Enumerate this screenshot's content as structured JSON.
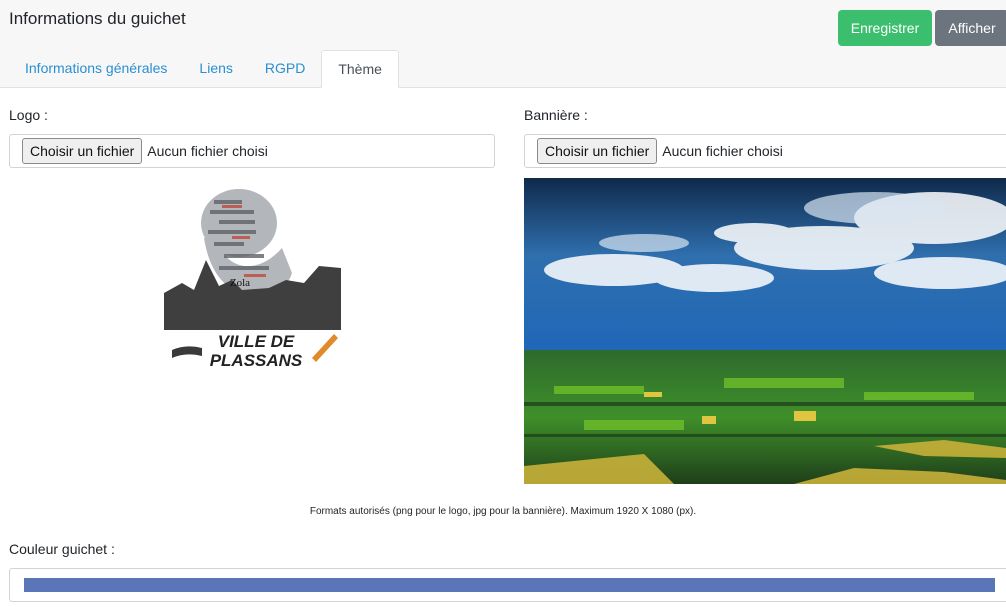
{
  "header": {
    "title": "Informations du guichet",
    "save_label": "Enregistrer",
    "show_label": "Afficher"
  },
  "tabs": [
    {
      "label": "Informations générales",
      "active": false
    },
    {
      "label": "Liens",
      "active": false
    },
    {
      "label": "RGPD",
      "active": false
    },
    {
      "label": "Thème",
      "active": true
    }
  ],
  "logo": {
    "label": "Logo :",
    "choose_button": "Choisir un fichier",
    "status": "Aucun fichier choisi",
    "image_text_line1": "VILLE DE",
    "image_text_line2": "PLASSANS",
    "image_text_name": "Zola"
  },
  "banner": {
    "label": "Bannière :",
    "choose_button": "Choisir un fichier",
    "status": "Aucun fichier choisi"
  },
  "formats_note": "Formats autorisés (png pour le logo, jpg pour la bannière). Maximum 1920 X 1080 (px).",
  "color": {
    "label": "Couleur guichet :",
    "value": "#5b76b8"
  },
  "colors": {
    "save_button": "#3bbf6f",
    "show_button": "#6c757d",
    "tab_link": "#2a8fd0"
  }
}
